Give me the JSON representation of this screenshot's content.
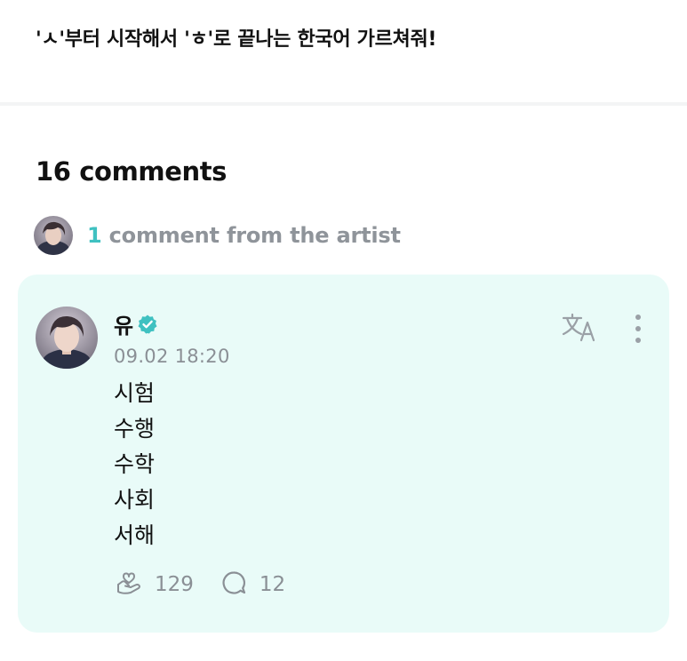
{
  "post": {
    "text": "'ㅅ'부터 시작해서 'ㅎ'로 끝나는 한국어 가르쳐줘!"
  },
  "comments": {
    "heading": "16 comments",
    "artist_count": "1",
    "artist_label": " comment from the artist"
  },
  "comment": {
    "author": "유",
    "timestamp": "09.02 18:20",
    "lines": [
      "시험",
      "수행",
      "수학",
      "사회",
      "서해"
    ],
    "like_count": "129",
    "reply_count": "12"
  },
  "icons": {
    "verified": "verified-badge-icon",
    "translate": "translate-icon",
    "more": "more-vertical-icon",
    "like": "heart-hand-icon",
    "reply": "reply-bubble-icon"
  },
  "colors": {
    "accent": "#3fc1c1",
    "card_background": "#e9fbf8",
    "muted_text": "#8a8f95"
  }
}
